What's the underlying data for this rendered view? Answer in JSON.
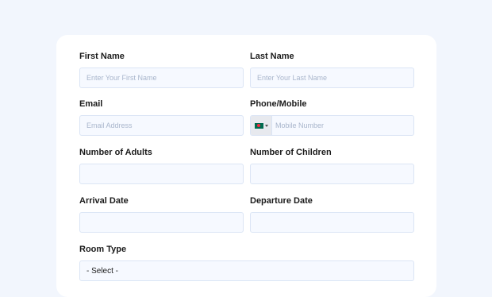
{
  "form": {
    "first_name": {
      "label": "First Name",
      "placeholder": "Enter Your First Name"
    },
    "last_name": {
      "label": "Last Name",
      "placeholder": "Enter Your Last Name"
    },
    "email": {
      "label": "Email",
      "placeholder": "Email Address"
    },
    "phone": {
      "label": "Phone/Mobile",
      "placeholder": "Mobile Number",
      "country_icon": "bangladesh-flag-icon"
    },
    "adults": {
      "label": "Number of Adults",
      "placeholder": ""
    },
    "children": {
      "label": "Number of Children",
      "placeholder": ""
    },
    "arrival": {
      "label": "Arrival Date",
      "placeholder": ""
    },
    "departure": {
      "label": "Departure Date",
      "placeholder": ""
    },
    "room_type": {
      "label": "Room Type",
      "value": "- Select -"
    }
  },
  "colors": {
    "page_background": "#f2f6fd",
    "input_border": "#dbe5f5",
    "input_background": "#f6f9ff",
    "placeholder": "#a9b6cc"
  }
}
